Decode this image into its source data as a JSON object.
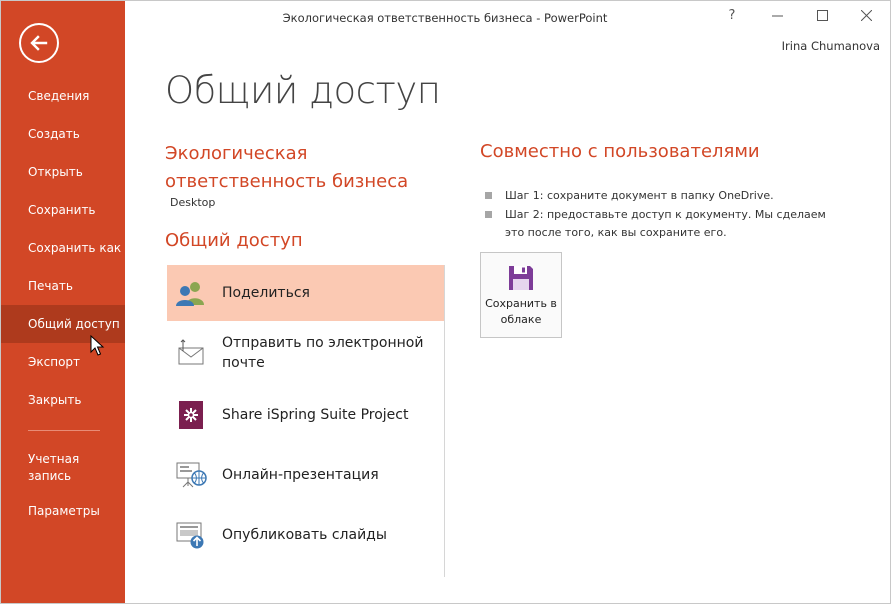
{
  "window": {
    "title": "Экологическая ответственность бизнеса - PowerPoint",
    "help_label": "?",
    "user_name": "Irina Chumanova"
  },
  "sidebar": {
    "items": [
      {
        "label": "Сведения"
      },
      {
        "label": "Создать"
      },
      {
        "label": "Открыть"
      },
      {
        "label": "Сохранить"
      },
      {
        "label": "Сохранить как"
      },
      {
        "label": "Печать"
      },
      {
        "label": "Общий доступ"
      },
      {
        "label": "Экспорт"
      },
      {
        "label": "Закрыть"
      }
    ],
    "account_label": "Учетная запись",
    "options_label": "Параметры"
  },
  "main": {
    "page_title": "Общий доступ",
    "document_name": "Экологическая ответственность бизнеса",
    "document_location": "Desktop",
    "section_title": "Общий доступ",
    "options": [
      {
        "label": "Поделиться",
        "icon": "people-icon"
      },
      {
        "label": "Отправить по электронной почте",
        "icon": "email-icon"
      },
      {
        "label": "Share iSpring Suite Project",
        "icon": "ispring-icon"
      },
      {
        "label": "Онлайн-презентация",
        "icon": "online-presentation-icon"
      },
      {
        "label": "Опубликовать слайды",
        "icon": "publish-slides-icon"
      }
    ]
  },
  "share_panel": {
    "title": "Совместно с пользователями",
    "steps": [
      "Шаг 1: сохраните документ в папку OneDrive.",
      "Шаг 2: предоставьте доступ к документу. Мы сделаем это после того, как вы сохраните его."
    ],
    "save_to_cloud_label": "Сохранить в облаке"
  },
  "colors": {
    "accent": "#d24726",
    "sidebar_active": "#ae3a1d",
    "selected_option": "#fbc9b3",
    "save_icon": "#7d3c98"
  }
}
